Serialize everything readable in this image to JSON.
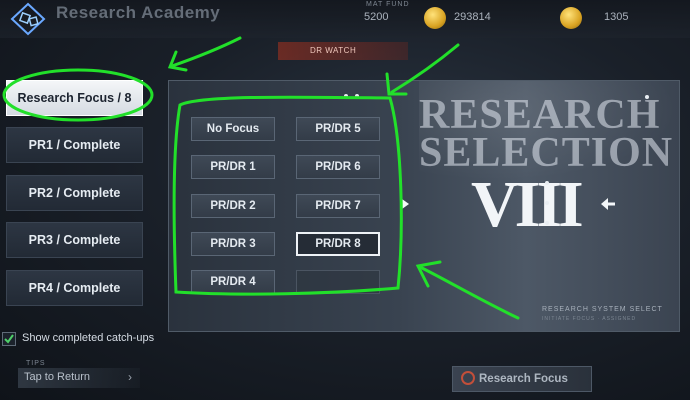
{
  "colors": {
    "annotation": "#22e02a",
    "accent": "#eef2f6",
    "panel": "#394350",
    "coin": "#d9a322"
  },
  "topbar": {
    "title": "Research Academy",
    "back_icon": "diamond-logo-icon",
    "resources": [
      {
        "label": "MAT FUND",
        "value": "5200"
      },
      {
        "label": "",
        "value": "293814"
      },
      {
        "label": "",
        "value": "1305"
      }
    ]
  },
  "banner": {
    "text": "DR WATCH"
  },
  "sidebar": {
    "items": [
      {
        "label": "Research Focus / 8",
        "active": true
      },
      {
        "label": "PR1 / Complete"
      },
      {
        "label": "PR2 / Complete"
      },
      {
        "label": "PR3 / Complete"
      },
      {
        "label": "PR4 / Complete"
      }
    ],
    "checkbox": {
      "label": "Show completed catch-ups",
      "checked": true
    },
    "tips": "TIPS",
    "return_label": "Tap to Return",
    "return_chevron": "›"
  },
  "focus_options": [
    {
      "label": "No Focus"
    },
    {
      "label": "PR/DR 1"
    },
    {
      "label": "PR/DR 2"
    },
    {
      "label": "PR/DR 3"
    },
    {
      "label": "PR/DR 4"
    },
    {
      "label": "PR/DR 5"
    },
    {
      "label": "PR/DR 6"
    },
    {
      "label": "PR/DR 7"
    },
    {
      "label": "PR/DR 8",
      "selected": true
    },
    {
      "label": ""
    }
  ],
  "selection_art": {
    "title_line1": "RESEARCH",
    "title_line2": "SELECTION",
    "roman": "VIII",
    "caption_main": "RESEARCH SYSTEM SELECT",
    "caption_sub": "INITIATE FOCUS · ASSIGNED"
  },
  "bottom_button": {
    "label": "Research Focus"
  }
}
